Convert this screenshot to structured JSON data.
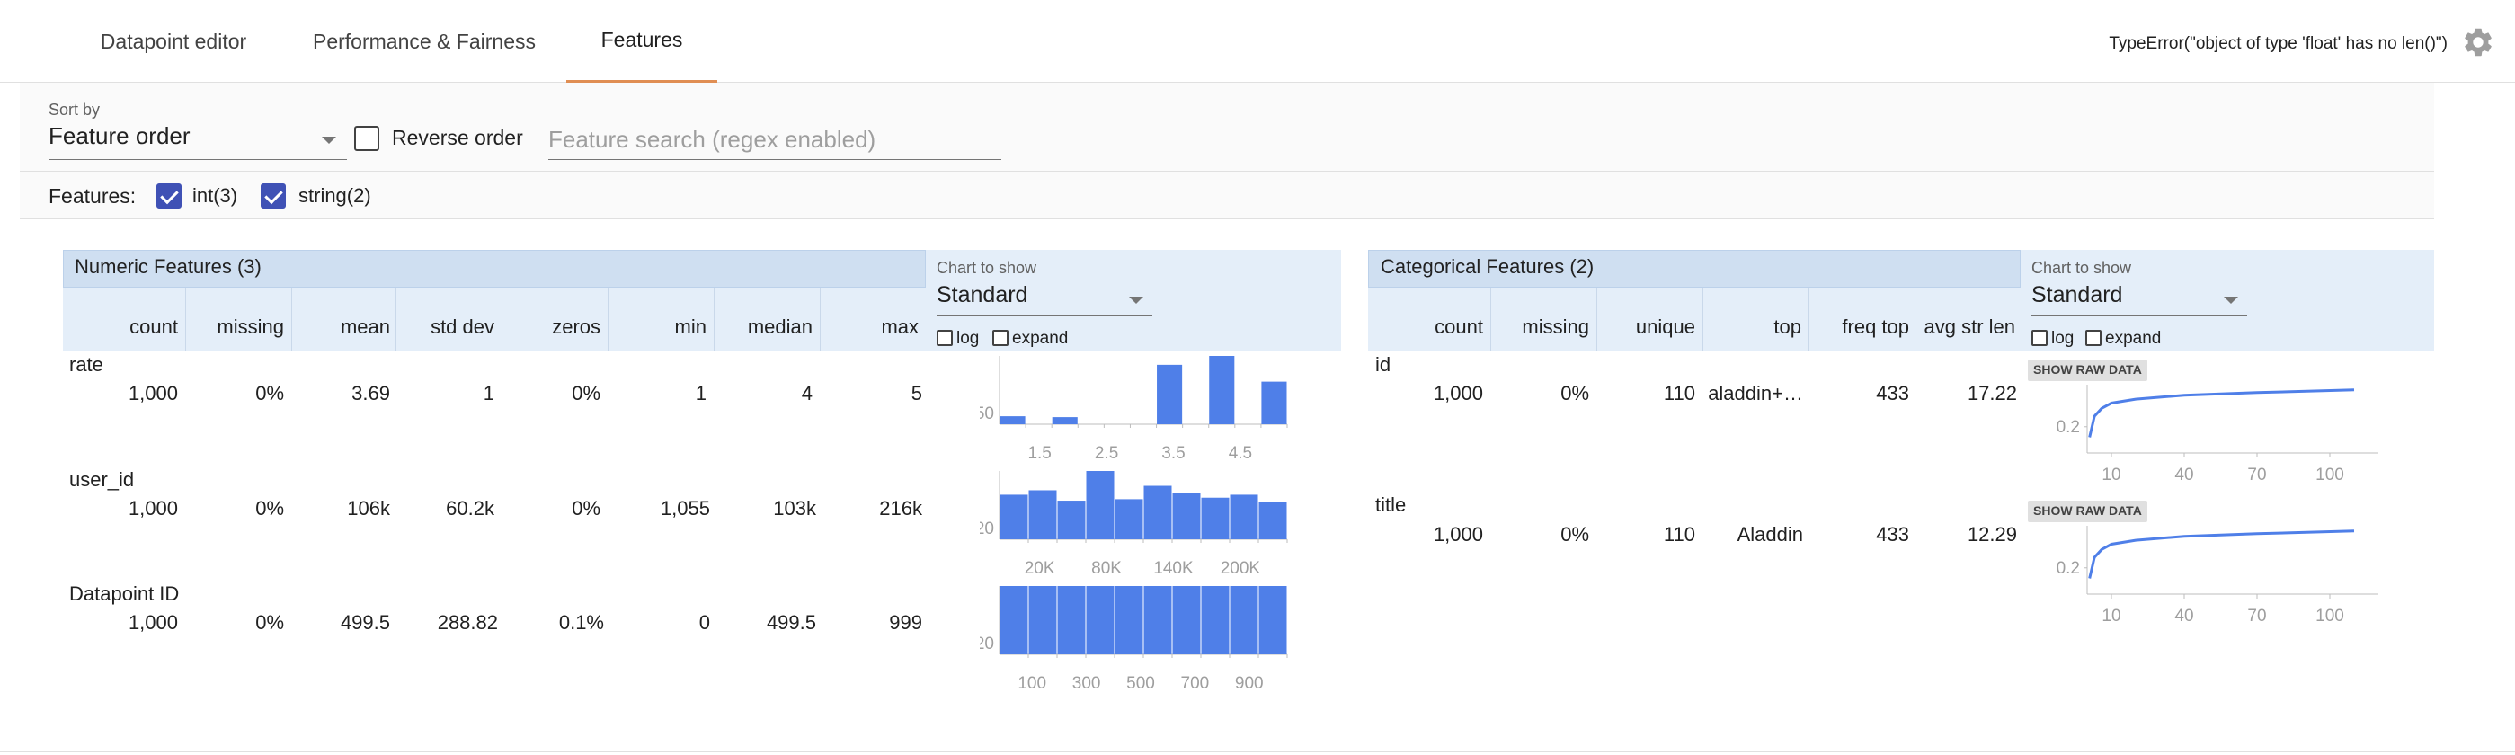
{
  "tabs": [
    "Datapoint editor",
    "Performance & Fairness",
    "Features"
  ],
  "active_tab": "Features",
  "error_text": "TypeError(\"object of type 'float' has no len()\")",
  "controls": {
    "sort_by_label": "Sort by",
    "sort_by_value": "Feature order",
    "reverse_order_label": "Reverse order",
    "reverse_order_checked": false,
    "search_placeholder": "Feature search (regex enabled)",
    "features_label": "Features:",
    "filters": [
      {
        "label": "int(3)",
        "checked": true
      },
      {
        "label": "string(2)",
        "checked": true
      }
    ]
  },
  "numeric": {
    "title": "Numeric Features (3)",
    "columns": [
      "count",
      "missing",
      "mean",
      "std dev",
      "zeros",
      "min",
      "median",
      "max"
    ],
    "chart_to_show_label": "Chart to show",
    "chart_to_show_value": "Standard",
    "log_label": "log",
    "expand_label": "expand",
    "rows": [
      {
        "name": "rate",
        "values": [
          "1,000",
          "0%",
          "3.69",
          "1",
          "0%",
          "1",
          "4",
          "5"
        ]
      },
      {
        "name": "user_id",
        "values": [
          "1,000",
          "0%",
          "106k",
          "60.2k",
          "0%",
          "1,055",
          "103k",
          "216k"
        ]
      },
      {
        "name": "Datapoint ID",
        "values": [
          "1,000",
          "0%",
          "499.5",
          "288.82",
          "0.1%",
          "0",
          "499.5",
          "999"
        ]
      }
    ]
  },
  "categorical": {
    "title": "Categorical Features (2)",
    "columns": [
      "count",
      "missing",
      "unique",
      "top",
      "freq top",
      "avg str len"
    ],
    "chart_to_show_label": "Chart to show",
    "chart_to_show_value": "Standard",
    "log_label": "log",
    "expand_label": "expand",
    "raw_button_label": "SHOW RAW DATA",
    "rows": [
      {
        "name": "id",
        "values": [
          "1,000",
          "0%",
          "110",
          "aladdin+…",
          "433",
          "17.22"
        ]
      },
      {
        "name": "title",
        "values": [
          "1,000",
          "0%",
          "110",
          "Aladdin",
          "433",
          "12.29"
        ]
      }
    ]
  },
  "chart_data": [
    {
      "type": "bar",
      "title": "rate",
      "ytick": "50",
      "xticks": [
        "1.5",
        "2.5",
        "3.5",
        "4.5"
      ],
      "values": [
        9,
        0,
        8,
        0,
        0,
        0,
        67,
        0,
        77,
        0,
        48
      ]
    },
    {
      "type": "bar",
      "title": "user_id",
      "ytick": "20",
      "xticks": [
        "20K",
        "80K",
        "140K",
        "200K"
      ],
      "values": [
        30,
        33,
        26,
        46,
        27,
        36,
        31,
        28,
        30,
        25
      ]
    },
    {
      "type": "bar",
      "title": "Datapoint ID",
      "ytick": "20",
      "xticks": [
        "100",
        "300",
        "500",
        "700",
        "900"
      ],
      "values": [
        40,
        40,
        40,
        40,
        40,
        40,
        40,
        40,
        40,
        40
      ]
    },
    {
      "type": "line",
      "title": "id",
      "ytick": "0.2",
      "xticks": [
        "10",
        "40",
        "70",
        "100"
      ],
      "x": [
        1,
        3,
        6,
        10,
        20,
        40,
        70,
        110
      ],
      "y": [
        0.12,
        0.28,
        0.34,
        0.38,
        0.41,
        0.44,
        0.46,
        0.48
      ]
    },
    {
      "type": "line",
      "title": "title",
      "ytick": "0.2",
      "xticks": [
        "10",
        "40",
        "70",
        "100"
      ],
      "x": [
        1,
        3,
        6,
        10,
        20,
        40,
        70,
        110
      ],
      "y": [
        0.12,
        0.28,
        0.34,
        0.38,
        0.41,
        0.44,
        0.46,
        0.48
      ]
    }
  ],
  "colors": {
    "bar": "#4f7fe8",
    "line": "#4f7fe8",
    "accent": "#3f51b5",
    "tab_underline": "#e08e53",
    "header_bg": "#cfdff1"
  }
}
